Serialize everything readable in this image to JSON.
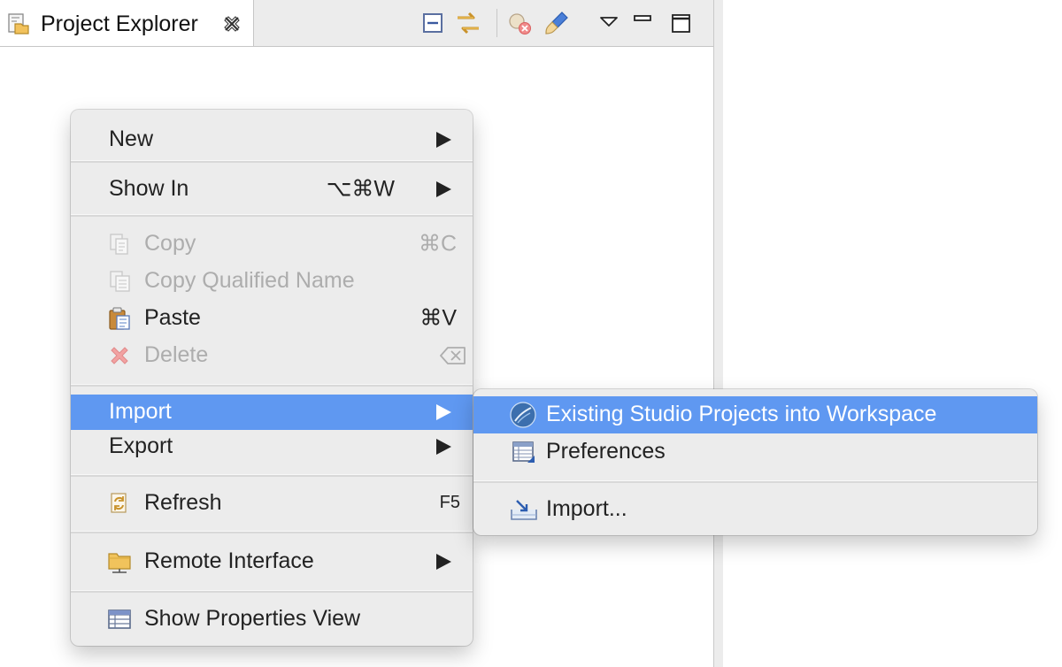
{
  "view": {
    "tab_label": "Project Explorer",
    "tab_icon": "project-explorer-icon",
    "close_icon": "close-icon",
    "toolbar": [
      {
        "name": "collapse-all-button",
        "icon": "collapse-all-icon"
      },
      {
        "name": "link-with-editor-button",
        "icon": "link-with-editor-icon"
      },
      {
        "name": "remove-launches-button",
        "icon": "remove-icon"
      },
      {
        "name": "brush-button",
        "icon": "brush-icon"
      },
      {
        "name": "view-menu-button",
        "icon": "triangle-down-icon"
      },
      {
        "name": "minimize-button",
        "icon": "minimize-icon"
      },
      {
        "name": "maximize-button",
        "icon": "maximize-icon"
      }
    ]
  },
  "context_menu": {
    "new": {
      "label": "New"
    },
    "show_in": {
      "label": "Show In",
      "shortcut": "⌥⌘W"
    },
    "copy": {
      "label": "Copy",
      "shortcut": "⌘C",
      "icon": "copy-icon"
    },
    "copy_qualified_name": {
      "label": "Copy Qualified Name",
      "icon": "copy-qualified-name-icon"
    },
    "paste": {
      "label": "Paste",
      "shortcut": "⌘V",
      "icon": "paste-icon"
    },
    "delete": {
      "label": "Delete",
      "icon": "delete-icon",
      "shortcut_icon": "delete-key-icon"
    },
    "import": {
      "label": "Import"
    },
    "export": {
      "label": "Export"
    },
    "refresh": {
      "label": "Refresh",
      "shortcut": "F5",
      "icon": "refresh-icon"
    },
    "remote_interface": {
      "label": "Remote Interface",
      "icon": "remote-folder-icon"
    },
    "show_properties_view": {
      "label": "Show Properties View",
      "icon": "properties-view-icon"
    }
  },
  "import_submenu": {
    "existing_projects": {
      "label": "Existing Studio Projects into Workspace",
      "icon": "studio-icon"
    },
    "preferences": {
      "label": "Preferences",
      "icon": "preferences-icon"
    },
    "import_wizard": {
      "label": "Import...",
      "icon": "import-icon"
    }
  },
  "colors": {
    "highlight": "#5f98f1",
    "menu_bg": "#ececec",
    "disabled_text": "#adadad"
  }
}
